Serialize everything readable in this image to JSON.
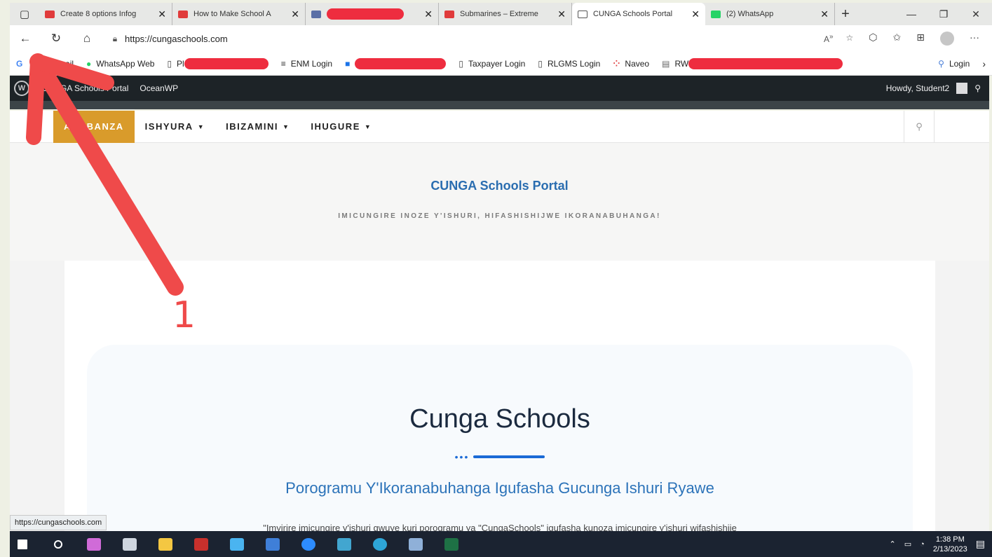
{
  "browser": {
    "tabs": [
      {
        "label": "Create 8 options Infog",
        "fav_color": "#e03b3b",
        "active": false
      },
      {
        "label": "How to Make School A",
        "fav_color": "#e03b3b",
        "active": false
      },
      {
        "label": "",
        "fav_color": "#5a6fa6",
        "active": false,
        "redacted": true
      },
      {
        "label": "Submarines – Extreme",
        "fav_color": "#e03b3b",
        "active": false
      },
      {
        "label": "CUNGA Schools Portal",
        "fav_color": "#ffffff",
        "active": true
      },
      {
        "label": "(2) WhatsApp",
        "fav_color": "#25d366",
        "active": false
      }
    ],
    "new_tab": "+",
    "window_controls": {
      "minimize": "—",
      "restore": "❐",
      "close": "✕"
    },
    "url": "https://cungaschools.com",
    "bookmarks": [
      {
        "icon": "G",
        "label": "",
        "color": "#4285f4"
      },
      {
        "icon": "G",
        "label": "Gmail",
        "color": "#4285f4"
      },
      {
        "icon": "●",
        "label": "WhatsApp Web",
        "color": "#25d366"
      },
      {
        "icon": "▯",
        "label": "Pl",
        "color": "#444444",
        "redact_width": 120
      },
      {
        "icon": "≡",
        "label": "ENM Login",
        "color": "#333333"
      },
      {
        "icon": "■",
        "label": "",
        "color": "#1a73e8",
        "redact_width": 130
      },
      {
        "icon": "▯",
        "label": "Taxpayer Login",
        "color": "#444444"
      },
      {
        "icon": "▯",
        "label": "RLGMS Login",
        "color": "#444444"
      },
      {
        "icon": "⁘",
        "label": "Naveo",
        "color": "#e04040"
      },
      {
        "icon": "▤",
        "label": "RW",
        "color": "#666666",
        "redact_width": 220
      }
    ],
    "bookmark_login": "Login",
    "status_url": "https://cungaschools.com"
  },
  "wp_admin": {
    "site_name": "CUNGA Schools Portal",
    "theme": "OceanWP",
    "greeting": "Howdy, Student2"
  },
  "site": {
    "menu": [
      {
        "label": "AHABANZA",
        "active": true,
        "dropdown": false
      },
      {
        "label": "ISHYURA",
        "active": false,
        "dropdown": true
      },
      {
        "label": "IBIZAMINI",
        "active": false,
        "dropdown": true
      },
      {
        "label": "IHUGURE",
        "active": false,
        "dropdown": true
      }
    ],
    "title": "CUNGA Schools Portal",
    "tagline": "IMICUNGIRE INOZE Y'ISHURI, HIFASHISHIJWE IKORANABUHANGA!",
    "hero_title": "Cunga Schools",
    "hero_subtitle": "Porogramu Y'Ikoranabuhanga Igufasha Gucunga Ishuri Ryawe",
    "hero_paragraph": "\"Imyirire imicungire y'ishuri gwuye kuri porogramu ya \"CungaSchools\" igufasha kunoza imicungire y'ishuri wifashishije"
  },
  "taskbar": {
    "time": "1:38 PM",
    "date": "2/13/2023",
    "apps": [
      {
        "name": "windows-start",
        "color": "#ffffff"
      },
      {
        "name": "search",
        "color": "#ffffff"
      },
      {
        "name": "paint",
        "color": "#d06bd8"
      },
      {
        "name": "terminal",
        "color": "#cfd6e0"
      },
      {
        "name": "file-explorer",
        "color": "#f4c742"
      },
      {
        "name": "filezilla",
        "color": "#c8302c"
      },
      {
        "name": "internet-explorer",
        "color": "#4ab4f0"
      },
      {
        "name": "app-blue",
        "color": "#3f7fd8"
      },
      {
        "name": "zoom",
        "color": "#2d8cff"
      },
      {
        "name": "app-teal",
        "color": "#42a6d0"
      },
      {
        "name": "edge",
        "color": "#2ea6d8"
      },
      {
        "name": "network",
        "color": "#8fb0d8"
      },
      {
        "name": "excel",
        "color": "#1e7145"
      }
    ]
  },
  "annotation": {
    "number": "1",
    "color": "#ef4a4a"
  }
}
